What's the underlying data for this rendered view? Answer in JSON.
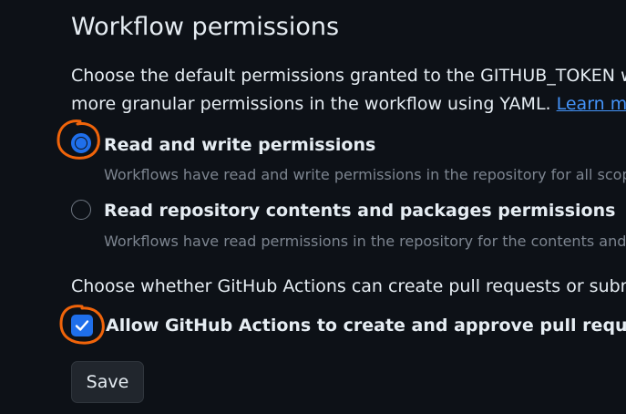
{
  "section": {
    "title": "Workflow permissions",
    "description_line1": "Choose the default permissions granted to the GITHUB_TOKEN wh",
    "description_line2": "more granular permissions in the workflow using YAML. ",
    "learn_more": "Learn mor"
  },
  "permissions": {
    "options": [
      {
        "label": "Read and write permissions",
        "help": "Workflows have read and write permissions in the repository for all scop",
        "selected": true
      },
      {
        "label": "Read repository contents and packages permissions",
        "help": "Workflows have read permissions in the repository for the contents and",
        "selected": false
      }
    ]
  },
  "actions_pr": {
    "text": "Choose whether GitHub Actions can create pull requests or submi",
    "checkbox_label": "Allow GitHub Actions to create and approve pull requests",
    "checked": true
  },
  "save_label": "Save",
  "colors": {
    "background": "#0d1117",
    "accent": "#1f6feb",
    "link": "#4493f8",
    "annotation": "#f0640a"
  }
}
